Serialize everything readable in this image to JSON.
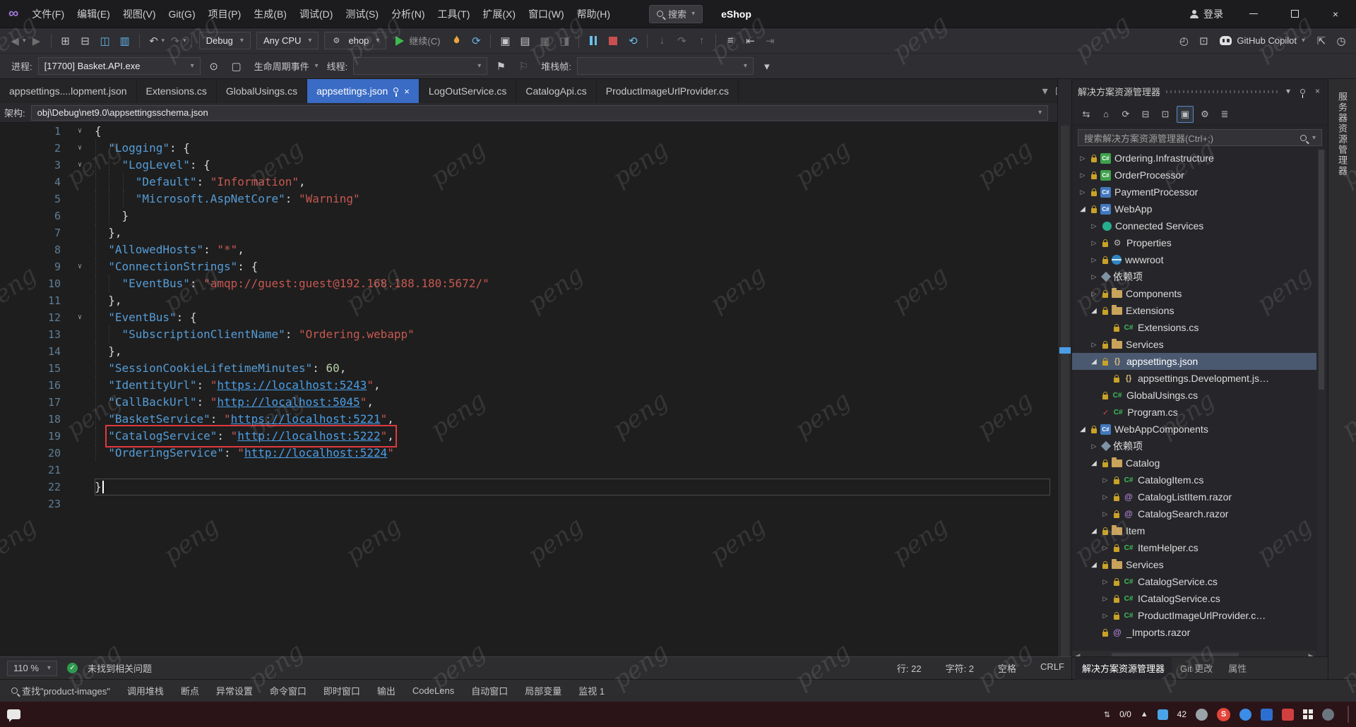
{
  "watermark": {
    "text": "peng"
  },
  "titlebar": {
    "menus": [
      "文件(F)",
      "编辑(E)",
      "视图(V)",
      "Git(G)",
      "项目(P)",
      "生成(B)",
      "调试(D)",
      "测试(S)",
      "分析(N)",
      "工具(T)",
      "扩展(X)",
      "窗口(W)",
      "帮助(H)"
    ],
    "search": "搜索",
    "solution": "eShop",
    "signin": "登录"
  },
  "toolbar": {
    "config": "Debug",
    "platform": "Any CPU",
    "startup": "ehop",
    "continue_label": "继续(C)",
    "copilot": "GitHub Copilot"
  },
  "debugbar": {
    "process_label": "进程:",
    "process_value": "[17700] Basket.API.exe",
    "lifecycle_label": "生命周期事件",
    "thread_label": "线程:",
    "stackframe_label": "堆栈帧:"
  },
  "tabs": [
    {
      "label": "appsettings....lopment.json",
      "active": false
    },
    {
      "label": "Extensions.cs",
      "active": false
    },
    {
      "label": "GlobalUsings.cs",
      "active": false
    },
    {
      "label": "appsettings.json",
      "active": true
    },
    {
      "label": "LogOutService.cs",
      "active": false
    },
    {
      "label": "CatalogApi.cs",
      "active": false
    },
    {
      "label": "ProductImageUrlProvider.cs",
      "active": false
    }
  ],
  "schema_bar": {
    "label": "架构:",
    "value": "obj\\Debug\\net9.0\\appsettingsschema.json"
  },
  "editor": {
    "boxed_line": 19,
    "current_line": 22,
    "lines": [
      {
        "n": 1,
        "ind": 0,
        "fold": true,
        "t": [
          [
            "p",
            "{"
          ]
        ]
      },
      {
        "n": 2,
        "ind": 1,
        "fold": true,
        "t": [
          [
            "k",
            "\"Logging\""
          ],
          [
            "p",
            ": {"
          ]
        ]
      },
      {
        "n": 3,
        "ind": 2,
        "fold": true,
        "t": [
          [
            "k",
            "\"LogLevel\""
          ],
          [
            "p",
            ": {"
          ]
        ]
      },
      {
        "n": 4,
        "ind": 3,
        "fold": false,
        "t": [
          [
            "k",
            "\"Default\""
          ],
          [
            "p",
            ": "
          ],
          [
            "s",
            "\"Information\""
          ],
          [
            "p",
            ","
          ]
        ]
      },
      {
        "n": 5,
        "ind": 3,
        "fold": false,
        "t": [
          [
            "k",
            "\"Microsoft.AspNetCore\""
          ],
          [
            "p",
            ": "
          ],
          [
            "s",
            "\"Warning\""
          ]
        ]
      },
      {
        "n": 6,
        "ind": 2,
        "fold": false,
        "t": [
          [
            "p",
            "}"
          ]
        ]
      },
      {
        "n": 7,
        "ind": 1,
        "fold": false,
        "t": [
          [
            "p",
            "},"
          ]
        ]
      },
      {
        "n": 8,
        "ind": 1,
        "fold": false,
        "t": [
          [
            "k",
            "\"AllowedHosts\""
          ],
          [
            "p",
            ": "
          ],
          [
            "s",
            "\"*\""
          ],
          [
            "p",
            ","
          ]
        ]
      },
      {
        "n": 9,
        "ind": 1,
        "fold": true,
        "t": [
          [
            "k",
            "\"ConnectionStrings\""
          ],
          [
            "p",
            ": {"
          ]
        ]
      },
      {
        "n": 10,
        "ind": 2,
        "fold": false,
        "t": [
          [
            "k",
            "\"EventBus\""
          ],
          [
            "p",
            ": "
          ],
          [
            "s",
            "\"amqp://guest:guest@192.168.188.180:5672/\""
          ]
        ]
      },
      {
        "n": 11,
        "ind": 1,
        "fold": false,
        "t": [
          [
            "p",
            "},"
          ]
        ]
      },
      {
        "n": 12,
        "ind": 1,
        "fold": true,
        "t": [
          [
            "k",
            "\"EventBus\""
          ],
          [
            "p",
            ": {"
          ]
        ]
      },
      {
        "n": 13,
        "ind": 2,
        "fold": false,
        "t": [
          [
            "k",
            "\"SubscriptionClientName\""
          ],
          [
            "p",
            ": "
          ],
          [
            "s",
            "\"Ordering.webapp\""
          ]
        ]
      },
      {
        "n": 14,
        "ind": 1,
        "fold": false,
        "t": [
          [
            "p",
            "},"
          ]
        ]
      },
      {
        "n": 15,
        "ind": 1,
        "fold": false,
        "t": [
          [
            "k",
            "\"SessionCookieLifetimeMinutes\""
          ],
          [
            "p",
            ": "
          ],
          [
            "n",
            "60"
          ],
          [
            "p",
            ","
          ]
        ]
      },
      {
        "n": 16,
        "ind": 1,
        "fold": false,
        "t": [
          [
            "k",
            "\"IdentityUrl\""
          ],
          [
            "p",
            ": "
          ],
          [
            "q",
            "\""
          ],
          [
            "l",
            "https://localhost:5243"
          ],
          [
            "q",
            "\""
          ],
          [
            "p",
            ","
          ]
        ]
      },
      {
        "n": 17,
        "ind": 1,
        "fold": false,
        "t": [
          [
            "k",
            "\"CallBackUrl\""
          ],
          [
            "p",
            ": "
          ],
          [
            "q",
            "\""
          ],
          [
            "l",
            "http://localhost:5045"
          ],
          [
            "q",
            "\""
          ],
          [
            "p",
            ","
          ]
        ]
      },
      {
        "n": 18,
        "ind": 1,
        "fold": false,
        "t": [
          [
            "k",
            "\"BasketService\""
          ],
          [
            "p",
            ": "
          ],
          [
            "q",
            "\""
          ],
          [
            "l",
            "https://localhost:5221"
          ],
          [
            "q",
            "\""
          ],
          [
            "p",
            ","
          ]
        ]
      },
      {
        "n": 19,
        "ind": 1,
        "fold": false,
        "t": [
          [
            "k",
            "\"CatalogService\""
          ],
          [
            "p",
            ": "
          ],
          [
            "q",
            "\""
          ],
          [
            "l",
            "http://localhost:5222"
          ],
          [
            "q",
            "\""
          ],
          [
            "p",
            ","
          ]
        ]
      },
      {
        "n": 20,
        "ind": 1,
        "fold": false,
        "t": [
          [
            "k",
            "\"OrderingService\""
          ],
          [
            "p",
            ": "
          ],
          [
            "q",
            "\""
          ],
          [
            "l",
            "http://localhost:5224"
          ],
          [
            "q",
            "\""
          ]
        ]
      },
      {
        "n": 21,
        "ind": 0,
        "fold": false,
        "t": []
      },
      {
        "n": 22,
        "ind": 0,
        "fold": false,
        "t": [
          [
            "p",
            "}"
          ]
        ]
      },
      {
        "n": 23,
        "ind": 0,
        "fold": false,
        "t": []
      }
    ]
  },
  "status": {
    "zoom": "110 %",
    "health": "未找到相关问题",
    "line": "行: 22",
    "col": "字符: 2",
    "spaces": "空格",
    "eol": "CRLF"
  },
  "bottom_tabs": [
    "查找\"product-images\"",
    "调用堆栈",
    "断点",
    "异常设置",
    "命令窗口",
    "即时窗口",
    "输出",
    "CodeLens",
    "自动窗口",
    "局部变量",
    "监视 1"
  ],
  "solution_explorer": {
    "title": "解决方案资源管理器",
    "search_placeholder": "搜索解决方案资源管理器(Ctrl+;)",
    "bottom_tabs": [
      "解决方案资源管理器",
      "Git 更改",
      "属性"
    ],
    "tree": [
      {
        "exp": "c",
        "lock": 1,
        "icon": "proj",
        "label": "Ordering.Infrastructure",
        "lvl": 0
      },
      {
        "exp": "c",
        "lock": 1,
        "icon": "proj",
        "label": "OrderProcessor",
        "lvl": 0
      },
      {
        "exp": "c",
        "lock": 1,
        "icon": "proj2",
        "label": "PaymentProcessor",
        "lvl": 0
      },
      {
        "exp": "e",
        "lock": 1,
        "icon": "proj2",
        "label": "WebApp",
        "lvl": 0
      },
      {
        "exp": "c",
        "lock": 0,
        "icon": "plug",
        "label": "Connected Services",
        "lvl": 1
      },
      {
        "exp": "c",
        "lock": 1,
        "icon": "wrench",
        "label": "Properties",
        "lvl": 1
      },
      {
        "exp": "c",
        "lock": 1,
        "icon": "globe",
        "label": "wwwroot",
        "lvl": 1
      },
      {
        "exp": "c",
        "lock": 0,
        "icon": "pkg",
        "label": "依赖项",
        "lvl": 1
      },
      {
        "exp": "c",
        "lock": 1,
        "icon": "folder",
        "label": "Components",
        "lvl": 1
      },
      {
        "exp": "e",
        "lock": 1,
        "icon": "folder",
        "label": "Extensions",
        "lvl": 1
      },
      {
        "exp": "",
        "lock": 1,
        "icon": "cs",
        "label": "Extensions.cs",
        "lvl": 2
      },
      {
        "exp": "c",
        "lock": 1,
        "icon": "folder",
        "label": "Services",
        "lvl": 1
      },
      {
        "exp": "e",
        "lock": 1,
        "icon": "json",
        "label": "appsettings.json",
        "lvl": 1,
        "sel": true
      },
      {
        "exp": "",
        "lock": 1,
        "icon": "json",
        "label": "appsettings.Development.js…",
        "lvl": 2
      },
      {
        "exp": "",
        "lock": 1,
        "icon": "cs",
        "label": "GlobalUsings.cs",
        "lvl": 1
      },
      {
        "exp": "",
        "check": 1,
        "icon": "cs",
        "label": "Program.cs",
        "lvl": 1
      },
      {
        "exp": "e",
        "lock": 1,
        "icon": "proj2",
        "label": "WebAppComponents",
        "lvl": 0
      },
      {
        "exp": "c",
        "lock": 0,
        "icon": "pkg",
        "label": "依赖项",
        "lvl": 1
      },
      {
        "exp": "e",
        "lock": 1,
        "icon": "folder",
        "label": "Catalog",
        "lvl": 1
      },
      {
        "exp": "c",
        "lock": 1,
        "icon": "cs",
        "label": "CatalogItem.cs",
        "lvl": 2
      },
      {
        "exp": "c",
        "lock": 1,
        "icon": "razor",
        "label": "CatalogListItem.razor",
        "lvl": 2
      },
      {
        "exp": "c",
        "lock": 1,
        "icon": "razor",
        "label": "CatalogSearch.razor",
        "lvl": 2
      },
      {
        "exp": "e",
        "lock": 1,
        "icon": "folder",
        "label": "Item",
        "lvl": 1
      },
      {
        "exp": "c",
        "lock": 1,
        "icon": "cs",
        "label": "ItemHelper.cs",
        "lvl": 2
      },
      {
        "exp": "e",
        "lock": 1,
        "icon": "folder",
        "label": "Services",
        "lvl": 1
      },
      {
        "exp": "c",
        "lock": 1,
        "icon": "cs",
        "label": "CatalogService.cs",
        "lvl": 2
      },
      {
        "exp": "c",
        "lock": 1,
        "icon": "cs",
        "label": "ICatalogService.cs",
        "lvl": 2
      },
      {
        "exp": "c",
        "lock": 1,
        "icon": "cs",
        "label": "ProductImageUrlProvider.c…",
        "lvl": 2
      },
      {
        "exp": "",
        "lock": 1,
        "icon": "razor",
        "label": "_Imports.razor",
        "lvl": 1
      }
    ]
  },
  "right_strip": {
    "label": "服务器资源管理器"
  },
  "taskbar": {
    "net": "0/0",
    "chevron": "▲",
    "temp": "42",
    "ime": "S"
  }
}
